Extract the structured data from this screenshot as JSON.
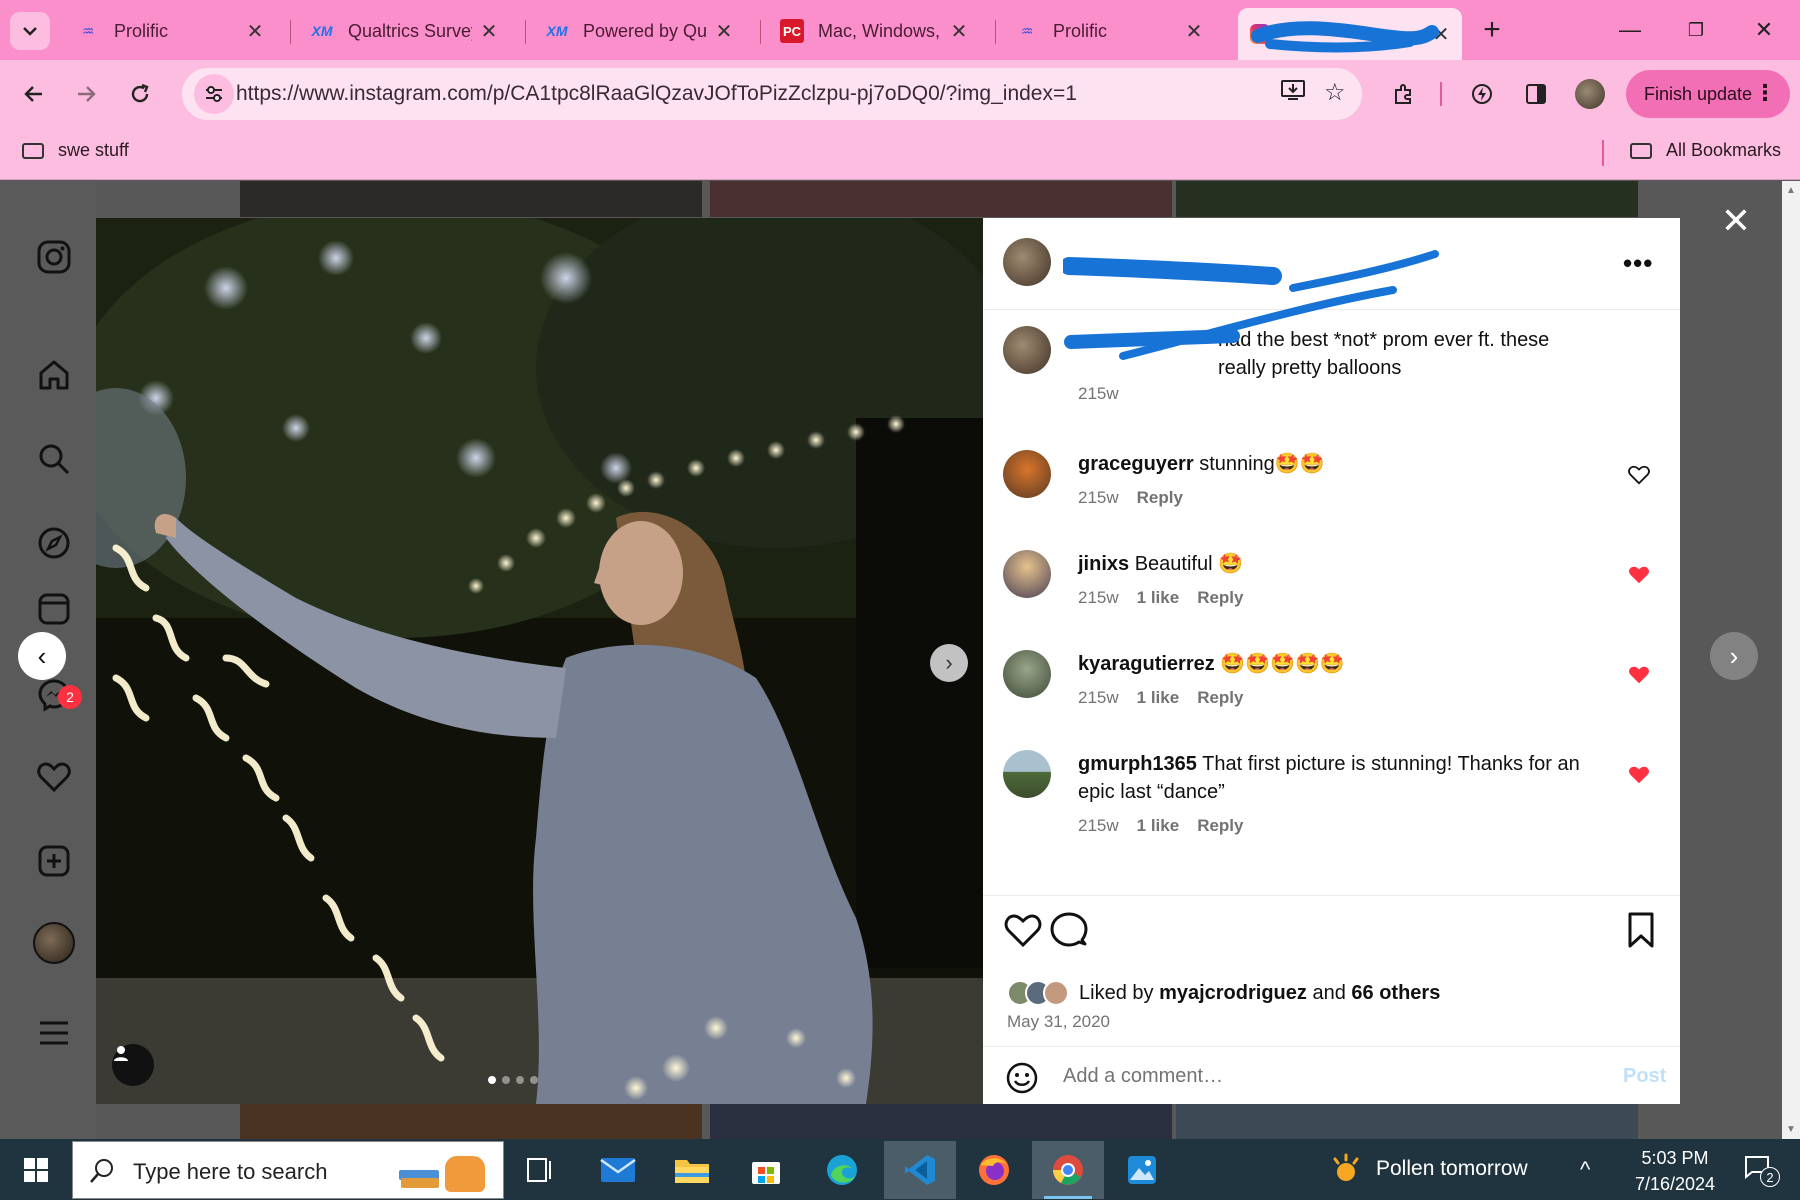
{
  "tabs": [
    {
      "title": "Prolific",
      "icon": "prolific-icon"
    },
    {
      "title": "Qualtrics Survey",
      "icon": "xm-icon"
    },
    {
      "title": "Powered by Qua",
      "icon": "xm-icon"
    },
    {
      "title": "Mac, Windows, (",
      "icon": "pc-icon"
    },
    {
      "title": "Prolific",
      "icon": "prolific-icon"
    },
    {
      "title": "",
      "icon": "instagram-icon"
    }
  ],
  "address": {
    "url": "https://www.instagram.com/p/CA1tpc8lRaaGlQzavJOfToPizZclzpu-pj7oDQ0/?img_index=1"
  },
  "toolbar": {
    "finish_update": "Finish update"
  },
  "bookmarks": {
    "left": "swe stuff",
    "right": "All Bookmarks"
  },
  "sidebar": {
    "badge": "2"
  },
  "post": {
    "caption": {
      "text": "had the best *not* prom ever ft. these really pretty balloons",
      "time": "215w"
    },
    "comments": [
      {
        "user": "graceguyerr",
        "text": "stunning🤩🤩",
        "time": "215w",
        "likes": "",
        "reply": "Reply",
        "liked": false
      },
      {
        "user": "jinixs",
        "text": "Beautiful 🤩",
        "time": "215w",
        "likes": "1 like",
        "reply": "Reply",
        "liked": true
      },
      {
        "user": "kyaragutierrez",
        "text": "🤩🤩🤩🤩🤩",
        "time": "215w",
        "likes": "1 like",
        "reply": "Reply",
        "liked": true
      },
      {
        "user": "gmurph1365",
        "text": "That first picture is stunning! Thanks for an epic last “dance”",
        "time": "215w",
        "likes": "1 like",
        "reply": "Reply",
        "liked": true
      }
    ],
    "liked_by": {
      "prefix": "Liked by",
      "user": "myajcrodriguez",
      "and": "and",
      "others": "66 others"
    },
    "date": "May 31, 2020",
    "add_comment_placeholder": "Add a comment…",
    "post_button": "Post"
  },
  "taskbar": {
    "search_placeholder": "Type here to search",
    "weather": "Pollen tomorrow",
    "time": "5:03 PM",
    "date": "7/16/2024",
    "notifications": "2"
  },
  "colors": {
    "tabbar": "#fb8fcb",
    "toolbar": "#fdbde0",
    "like_red": "#ff3040",
    "taskbar": "#20343f"
  }
}
